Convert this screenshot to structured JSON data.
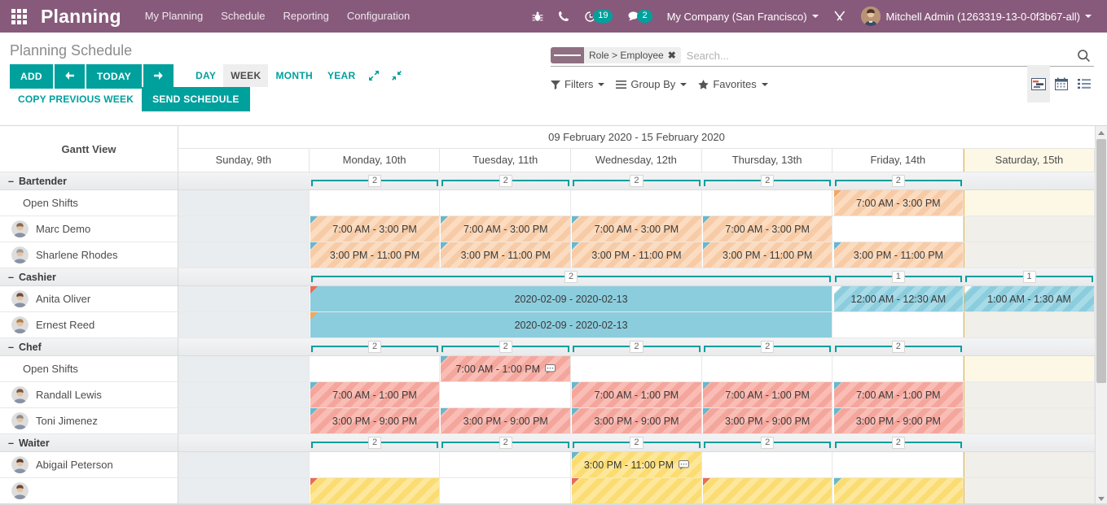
{
  "navbar": {
    "apps_icon": "apps-grid-icon",
    "brand": "Planning",
    "menu": [
      {
        "label": "My Planning"
      },
      {
        "label": "Schedule"
      },
      {
        "label": "Reporting"
      },
      {
        "label": "Configuration"
      }
    ],
    "bug_icon": "bug-icon",
    "phone_icon": "phone-icon",
    "activity_icon": "activity-clock-icon",
    "activity_count": "19",
    "messages_icon": "messages-icon",
    "messages_count": "2",
    "company": "My Company (San Francisco)",
    "debug_icon": "tools-wrench-icon",
    "user": "Mitchell Admin (1263319-13-0-0f3b67-all)",
    "accent": "#875a7b"
  },
  "control_panel": {
    "title": "Planning Schedule",
    "add_label": "ADD",
    "prev_icon": "arrow-left-icon",
    "today_label": "TODAY",
    "next_icon": "arrow-right-icon",
    "copy_previous_label": "COPY PREVIOUS WEEK",
    "send_schedule_label": "SEND SCHEDULE",
    "scales": [
      {
        "label": "DAY",
        "active": false
      },
      {
        "label": "WEEK",
        "active": true
      },
      {
        "label": "MONTH",
        "active": false
      },
      {
        "label": "YEAR",
        "active": false
      }
    ],
    "expand_icon": "expand-icon",
    "collapse_icon": "collapse-icon",
    "search": {
      "facet_label": "Role > Employee",
      "facet_remove_icon": "close-icon",
      "placeholder": "Search...",
      "value": "",
      "search_icon": "search-icon"
    },
    "filters_label": "Filters",
    "group_by_label": "Group By",
    "favorites_label": "Favorites",
    "views": [
      {
        "name": "gantt-view",
        "icon": "gantt-icon",
        "active": true
      },
      {
        "name": "calendar-view",
        "icon": "calendar-icon",
        "active": false
      },
      {
        "name": "list-view",
        "icon": "list-icon",
        "active": false
      }
    ],
    "accent": "#00a09d"
  },
  "gantt": {
    "view_label": "Gantt View",
    "period": "09 February 2020 - 15 February 2020",
    "days": [
      {
        "label": "Sunday, 9th",
        "weekend": false
      },
      {
        "label": "Monday, 10th",
        "weekend": false
      },
      {
        "label": "Tuesday, 11th",
        "weekend": false
      },
      {
        "label": "Wednesday, 12th",
        "weekend": false
      },
      {
        "label": "Thursday, 13th",
        "weekend": false
      },
      {
        "label": "Friday, 14th",
        "weekend": false
      },
      {
        "label": "Saturday, 15th",
        "weekend": true
      }
    ],
    "groups": [
      {
        "name": "Bartender",
        "counts": [
          {
            "day": 1,
            "span": 1,
            "value": "2"
          },
          {
            "day": 2,
            "span": 1,
            "value": "2"
          },
          {
            "day": 3,
            "span": 1,
            "value": "2"
          },
          {
            "day": 4,
            "span": 1,
            "value": "2"
          },
          {
            "day": 5,
            "span": 1,
            "value": "2"
          }
        ],
        "rows": [
          {
            "label": "Open Shifts",
            "avatar": false,
            "pills": [
              {
                "day": 5,
                "span": 1,
                "text": "7:00 AM - 3:00 PM",
                "style": "p-orange",
                "corner": "orange",
                "chat": false
              }
            ]
          },
          {
            "label": "Marc Demo",
            "avatar": true,
            "avatar_color": "#8a6a52",
            "pills": [
              {
                "day": 1,
                "span": 1,
                "text": "7:00 AM - 3:00 PM",
                "style": "p-orange",
                "corner": "blue",
                "chat": false
              },
              {
                "day": 2,
                "span": 1,
                "text": "7:00 AM - 3:00 PM",
                "style": "p-orange",
                "corner": "blue",
                "chat": false
              },
              {
                "day": 3,
                "span": 1,
                "text": "7:00 AM - 3:00 PM",
                "style": "p-orange",
                "corner": "blue",
                "chat": false
              },
              {
                "day": 4,
                "span": 1,
                "text": "7:00 AM - 3:00 PM",
                "style": "p-orange",
                "corner": "blue",
                "chat": false
              }
            ]
          },
          {
            "label": "Sharlene Rhodes",
            "avatar": true,
            "avatar_color": "#9c9c9c",
            "pills": [
              {
                "day": 1,
                "span": 1,
                "text": "3:00 PM - 11:00 PM",
                "style": "p-orange",
                "corner": "blue",
                "chat": false
              },
              {
                "day": 2,
                "span": 1,
                "text": "3:00 PM - 11:00 PM",
                "style": "p-orange",
                "corner": "blue",
                "chat": false
              },
              {
                "day": 3,
                "span": 1,
                "text": "3:00 PM - 11:00 PM",
                "style": "p-orange",
                "corner": "blue",
                "chat": false
              },
              {
                "day": 4,
                "span": 1,
                "text": "3:00 PM - 11:00 PM",
                "style": "p-orange",
                "corner": "blue",
                "chat": false
              },
              {
                "day": 5,
                "span": 1,
                "text": "3:00 PM - 11:00 PM",
                "style": "p-orange",
                "corner": "blue",
                "chat": false
              }
            ]
          }
        ]
      },
      {
        "name": "Cashier",
        "counts": [
          {
            "day": 1,
            "span": 4,
            "value": "2"
          },
          {
            "day": 5,
            "span": 1,
            "value": "1"
          },
          {
            "day": 6,
            "span": 1,
            "value": "1"
          }
        ],
        "rows": [
          {
            "label": "Anita Oliver",
            "avatar": true,
            "avatar_color": "#6d4b3a",
            "pills": [
              {
                "day": 1,
                "span": 4,
                "text": "2020-02-09 - 2020-02-13",
                "style": "p-cyan-solid",
                "corner": "red",
                "chat": false
              },
              {
                "day": 5,
                "span": 1,
                "text": "12:00 AM - 12:30 AM",
                "style": "p-cyan",
                "corner": "white",
                "chat": false
              },
              {
                "day": 6,
                "span": 1,
                "text": "1:00 AM - 1:30 AM",
                "style": "p-cyan",
                "corner": "white",
                "chat": false
              }
            ]
          },
          {
            "label": "Ernest Reed",
            "avatar": true,
            "avatar_color": "#b08050",
            "pills": [
              {
                "day": 1,
                "span": 4,
                "text": "2020-02-09 - 2020-02-13",
                "style": "p-cyan-solid",
                "corner": "orange",
                "chat": false
              }
            ]
          }
        ]
      },
      {
        "name": "Chef",
        "counts": [
          {
            "day": 1,
            "span": 1,
            "value": "2"
          },
          {
            "day": 2,
            "span": 1,
            "value": "2"
          },
          {
            "day": 3,
            "span": 1,
            "value": "2"
          },
          {
            "day": 4,
            "span": 1,
            "value": "2"
          },
          {
            "day": 5,
            "span": 1,
            "value": "2"
          }
        ],
        "rows": [
          {
            "label": "Open Shifts",
            "avatar": false,
            "pills": [
              {
                "day": 2,
                "span": 1,
                "text": "7:00 AM - 1:00 PM",
                "style": "p-red",
                "corner": "blue",
                "chat": true
              }
            ]
          },
          {
            "label": "Randall Lewis",
            "avatar": true,
            "avatar_color": "#7b5a44",
            "pills": [
              {
                "day": 1,
                "span": 1,
                "text": "7:00 AM - 1:00 PM",
                "style": "p-red",
                "corner": "blue",
                "chat": false
              },
              {
                "day": 3,
                "span": 1,
                "text": "7:00 AM - 1:00 PM",
                "style": "p-red",
                "corner": "blue",
                "chat": false
              },
              {
                "day": 4,
                "span": 1,
                "text": "7:00 AM - 1:00 PM",
                "style": "p-red",
                "corner": "blue",
                "chat": false
              },
              {
                "day": 5,
                "span": 1,
                "text": "7:00 AM - 1:00 PM",
                "style": "p-red",
                "corner": "blue",
                "chat": false
              }
            ]
          },
          {
            "label": "Toni Jimenez",
            "avatar": true,
            "avatar_color": "#8c8c8c",
            "pills": [
              {
                "day": 1,
                "span": 1,
                "text": "3:00 PM - 9:00 PM",
                "style": "p-red",
                "corner": "blue",
                "chat": false
              },
              {
                "day": 2,
                "span": 1,
                "text": "3:00 PM - 9:00 PM",
                "style": "p-red",
                "corner": "blue",
                "chat": false
              },
              {
                "day": 3,
                "span": 1,
                "text": "3:00 PM - 9:00 PM",
                "style": "p-red",
                "corner": "blue",
                "chat": false
              },
              {
                "day": 4,
                "span": 1,
                "text": "3:00 PM - 9:00 PM",
                "style": "p-red",
                "corner": "blue",
                "chat": false
              },
              {
                "day": 5,
                "span": 1,
                "text": "3:00 PM - 9:00 PM",
                "style": "p-red",
                "corner": "blue",
                "chat": false
              }
            ]
          }
        ]
      },
      {
        "name": "Waiter",
        "counts": [
          {
            "day": 1,
            "span": 1,
            "value": "2"
          },
          {
            "day": 2,
            "span": 1,
            "value": "2"
          },
          {
            "day": 3,
            "span": 1,
            "value": "2"
          },
          {
            "day": 4,
            "span": 1,
            "value": "2"
          },
          {
            "day": 5,
            "span": 1,
            "value": "2"
          }
        ],
        "rows": [
          {
            "label": "Abigail Peterson",
            "avatar": true,
            "avatar_color": "#5c4033",
            "pills": [
              {
                "day": 3,
                "span": 1,
                "text": "3:00 PM - 11:00 PM",
                "style": "p-yellow",
                "corner": "blue",
                "chat": true
              }
            ]
          },
          {
            "label": "",
            "avatar": true,
            "avatar_color": "#6b4a35",
            "partial": true,
            "pills": [
              {
                "day": 1,
                "span": 1,
                "text": "",
                "style": "p-yellow",
                "corner": "red",
                "chat": false
              },
              {
                "day": 3,
                "span": 1,
                "text": "",
                "style": "p-yellow",
                "corner": "red",
                "chat": false
              },
              {
                "day": 4,
                "span": 1,
                "text": "",
                "style": "p-yellow",
                "corner": "red",
                "chat": false
              },
              {
                "day": 5,
                "span": 1,
                "text": "",
                "style": "p-yellow",
                "corner": "blue",
                "chat": false
              }
            ]
          }
        ]
      }
    ]
  }
}
